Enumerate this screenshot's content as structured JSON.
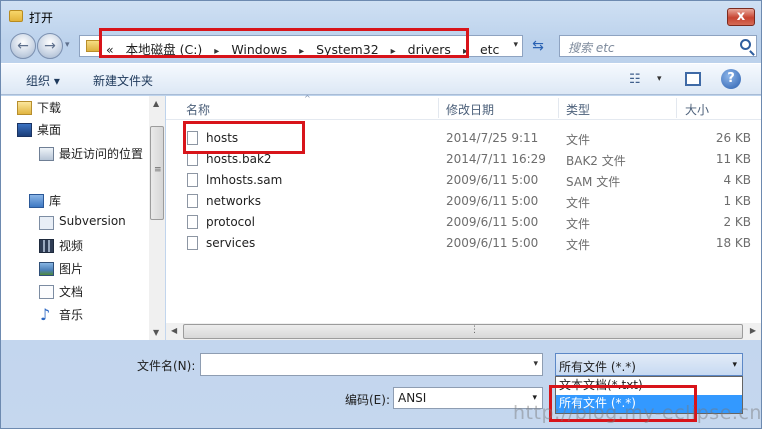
{
  "window": {
    "title": "打开",
    "close": "x"
  },
  "nav": {
    "back": "←",
    "forward": "→",
    "history": "▾",
    "breadcrumb": {
      "overflow": "«",
      "items": [
        "本地磁盘 (C:)",
        "Windows",
        "System32",
        "drivers",
        "etc"
      ],
      "separator": "▸",
      "dropdown": "▾"
    },
    "refresh": "⇆",
    "search": {
      "placeholder": "搜索 etc"
    }
  },
  "toolbar": {
    "organize": "组织 ▾",
    "new_folder": "新建文件夹",
    "view_icon": "☷",
    "view_drop": "▾",
    "help": "?"
  },
  "navpane": {
    "items": [
      {
        "label": "下载",
        "icon": "downloads-icon"
      },
      {
        "label": "桌面",
        "icon": "desktop-icon"
      },
      {
        "label": "最近访问的位置",
        "icon": "recent-places-icon"
      },
      {
        "label": "库",
        "icon": "library-icon"
      },
      {
        "label": "Subversion",
        "icon": "subversion-icon"
      },
      {
        "label": "视频",
        "icon": "video-icon"
      },
      {
        "label": "图片",
        "icon": "pictures-icon"
      },
      {
        "label": "文档",
        "icon": "documents-icon"
      },
      {
        "label": "音乐",
        "icon": "music-icon"
      }
    ],
    "scroll_up": "▲",
    "scroll_down": "▼",
    "grip": "≡"
  },
  "files": {
    "columns": {
      "name": "名称",
      "date": "修改日期",
      "type": "类型",
      "size": "大小",
      "sort": "^"
    },
    "rows": [
      {
        "name": "hosts",
        "date": "2014/7/25 9:11",
        "type": "文件",
        "size": "26 KB"
      },
      {
        "name": "hosts.bak2",
        "date": "2014/7/11 16:29",
        "type": "BAK2 文件",
        "size": "11 KB"
      },
      {
        "name": "lmhosts.sam",
        "date": "2009/6/11 5:00",
        "type": "SAM 文件",
        "size": "4 KB"
      },
      {
        "name": "networks",
        "date": "2009/6/11 5:00",
        "type": "文件",
        "size": "1 KB"
      },
      {
        "name": "protocol",
        "date": "2009/6/11 5:00",
        "type": "文件",
        "size": "2 KB"
      },
      {
        "name": "services",
        "date": "2009/6/11 5:00",
        "type": "文件",
        "size": "18 KB"
      }
    ],
    "hscroll_left": "◀",
    "hscroll_right": "▶",
    "hgrip": "⋮"
  },
  "bottom": {
    "filename_label": "文件名(N):",
    "filename_value": "",
    "filename_drop": "▾",
    "filetype_selected": "所有文件 (*.*)",
    "filetype_arrow": "▾",
    "filetype_options": [
      "文本文档(*.txt)",
      "所有文件 (*.*)"
    ],
    "encoding_label": "编码(E):",
    "encoding_value": "ANSI",
    "encoding_arrow": "▾"
  },
  "watermark": "http://blog.my-eclipse.cn/"
}
